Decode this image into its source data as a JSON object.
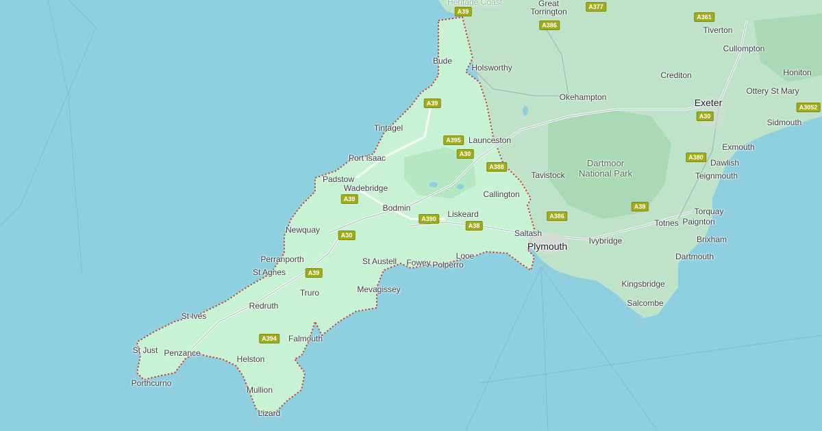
{
  "map": {
    "region_highlight_color": "#c8f2d4",
    "sea_color": "#8ecfe0",
    "land_color": "#bfe3c8",
    "border_color": "#d93025",
    "places": [
      {
        "name": "Bude",
        "kind": "town"
      },
      {
        "name": "Holsworthy",
        "kind": "town"
      },
      {
        "name": "Great",
        "kind": "town"
      },
      {
        "name": "Torrington",
        "kind": "town"
      },
      {
        "name": "Tiverton",
        "kind": "town"
      },
      {
        "name": "Cullompton",
        "kind": "town"
      },
      {
        "name": "Crediton",
        "kind": "town"
      },
      {
        "name": "Honiton",
        "kind": "town"
      },
      {
        "name": "Ottery St Mary",
        "kind": "town"
      },
      {
        "name": "Okehampton",
        "kind": "town"
      },
      {
        "name": "Exeter",
        "kind": "city"
      },
      {
        "name": "Sidmouth",
        "kind": "town"
      },
      {
        "name": "Tintagel",
        "kind": "town"
      },
      {
        "name": "Launceston",
        "kind": "town"
      },
      {
        "name": "Exmouth",
        "kind": "town"
      },
      {
        "name": "Port Isaac",
        "kind": "town"
      },
      {
        "name": "Dawlish",
        "kind": "town"
      },
      {
        "name": "Padstow",
        "kind": "town"
      },
      {
        "name": "Tavistock",
        "kind": "town"
      },
      {
        "name": "Teignmouth",
        "kind": "town"
      },
      {
        "name": "Wadebridge",
        "kind": "town"
      },
      {
        "name": "Callington",
        "kind": "town"
      },
      {
        "name": "Bodmin",
        "kind": "town"
      },
      {
        "name": "Torquay",
        "kind": "town"
      },
      {
        "name": "Liskeard",
        "kind": "town"
      },
      {
        "name": "Totnes",
        "kind": "town"
      },
      {
        "name": "Paignton",
        "kind": "town"
      },
      {
        "name": "Newquay",
        "kind": "town"
      },
      {
        "name": "Saltash",
        "kind": "town"
      },
      {
        "name": "Plymouth",
        "kind": "city"
      },
      {
        "name": "Ivybridge",
        "kind": "town"
      },
      {
        "name": "Brixham",
        "kind": "town"
      },
      {
        "name": "Perranporth",
        "kind": "town"
      },
      {
        "name": "St Austell",
        "kind": "town"
      },
      {
        "name": "Fowey",
        "kind": "town"
      },
      {
        "name": "Polperro",
        "kind": "town"
      },
      {
        "name": "Looe",
        "kind": "town"
      },
      {
        "name": "Dartmouth",
        "kind": "town"
      },
      {
        "name": "St Agnes",
        "kind": "town"
      },
      {
        "name": "Kingsbridge",
        "kind": "town"
      },
      {
        "name": "Truro",
        "kind": "town"
      },
      {
        "name": "Mevagissey",
        "kind": "town"
      },
      {
        "name": "Salcombe",
        "kind": "town"
      },
      {
        "name": "Redruth",
        "kind": "town"
      },
      {
        "name": "St Ives",
        "kind": "town"
      },
      {
        "name": "Falmouth",
        "kind": "town"
      },
      {
        "name": "St Just",
        "kind": "town"
      },
      {
        "name": "Penzance",
        "kind": "town"
      },
      {
        "name": "Helston",
        "kind": "town"
      },
      {
        "name": "Porthcurno",
        "kind": "town"
      },
      {
        "name": "Mullion",
        "kind": "town"
      },
      {
        "name": "Lizard",
        "kind": "town"
      },
      {
        "name": "Heritage Coast",
        "kind": "area"
      }
    ],
    "park_label": [
      "Dartmoor",
      "National Park"
    ],
    "roads": [
      "A39",
      "A377",
      "A361",
      "A386",
      "A3052",
      "A30",
      "A39",
      "A395",
      "A30",
      "A388",
      "A380",
      "A39",
      "A390",
      "A38",
      "A386",
      "A38",
      "A30",
      "A39",
      "A394"
    ]
  }
}
